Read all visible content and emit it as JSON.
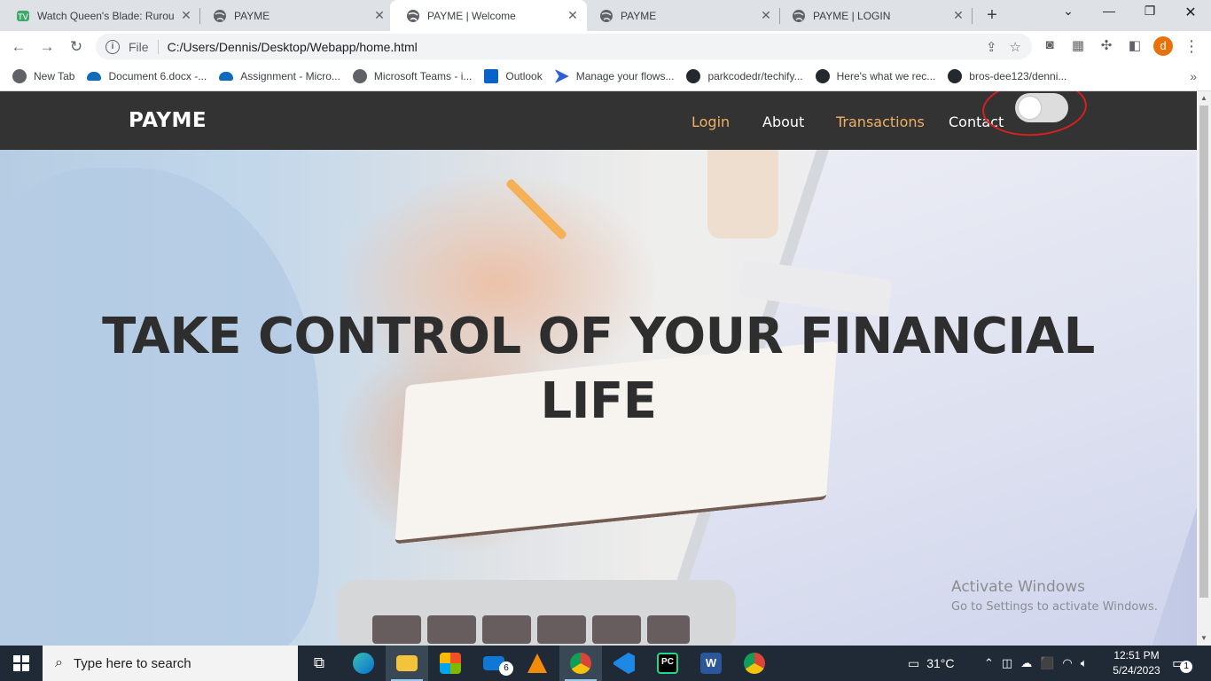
{
  "browser": {
    "tabs": [
      {
        "title": "Watch Queen's Blade: Rurou",
        "icon": "tv-icon",
        "active": false
      },
      {
        "title": "PAYME",
        "icon": "globe-icon",
        "active": false
      },
      {
        "title": "PAYME | Welcome",
        "icon": "globe-icon",
        "active": true
      },
      {
        "title": "PAYME",
        "icon": "globe-icon",
        "active": false
      },
      {
        "title": "PAYME | LOGIN",
        "icon": "globe-icon",
        "active": false
      }
    ],
    "address": {
      "scheme_label": "File",
      "url": "C:/Users/Dennis/Desktop/Webapp/home.html"
    },
    "profile_initial": "d",
    "bookmarks": [
      {
        "label": "New Tab",
        "icon": "globe-icon",
        "color": "#5f6368"
      },
      {
        "label": "Document 6.docx -...",
        "icon": "onedrive-icon",
        "color": "#0f6cbd"
      },
      {
        "label": "Assignment - Micro...",
        "icon": "onedrive-icon",
        "color": "#0f6cbd"
      },
      {
        "label": "Microsoft Teams - i...",
        "icon": "globe-icon",
        "color": "#5f6368"
      },
      {
        "label": "Outlook",
        "icon": "outlook-icon",
        "color": "#0a64c8"
      },
      {
        "label": "Manage your flows...",
        "icon": "power-automate-icon",
        "color": "#2d5fd6"
      },
      {
        "label": "parkcodedr/techify...",
        "icon": "github-icon",
        "color": "#24292f"
      },
      {
        "label": "Here's what we rec...",
        "icon": "github-icon",
        "color": "#24292f"
      },
      {
        "label": "bros-dee123/denni...",
        "icon": "github-icon",
        "color": "#24292f"
      }
    ]
  },
  "site": {
    "brand": "PAYME",
    "nav": [
      {
        "label": "Login",
        "highlight": true
      },
      {
        "label": "About",
        "highlight": false
      },
      {
        "label": "Transactions",
        "highlight": true
      },
      {
        "label": "Contact",
        "highlight": false
      }
    ],
    "theme_toggle": {
      "on": false
    },
    "headline_line1": "TAKE CONTROL OF YOUR FINANCIAL",
    "headline_line2": "LIFE",
    "accent_color": "#f0b062",
    "nav_bg": "#333333"
  },
  "watermark": {
    "line1": "Activate Windows",
    "line2": "Go to Settings to activate Windows."
  },
  "taskbar": {
    "search_placeholder": "Type here to search",
    "mail_badge": "6",
    "weather": "31°C",
    "time": "12:51 PM",
    "date": "5/24/2023",
    "notification_count": "1"
  }
}
